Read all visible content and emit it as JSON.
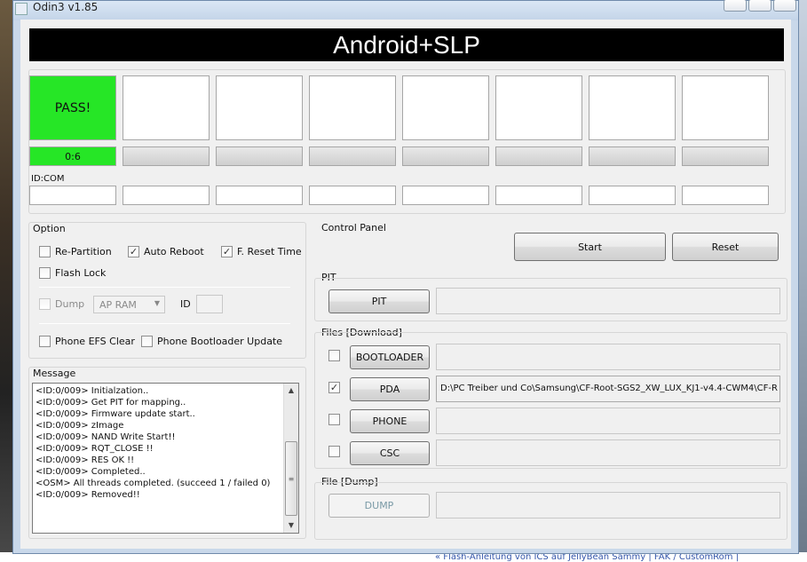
{
  "window": {
    "title": "Odin3 v1.85"
  },
  "banner": "Android+SLP",
  "slots": [
    {
      "status": "PASS!",
      "progress": "0:6",
      "pass": true
    },
    {
      "status": "",
      "progress": "",
      "pass": false
    },
    {
      "status": "",
      "progress": "",
      "pass": false
    },
    {
      "status": "",
      "progress": "",
      "pass": false
    },
    {
      "status": "",
      "progress": "",
      "pass": false
    },
    {
      "status": "",
      "progress": "",
      "pass": false
    },
    {
      "status": "",
      "progress": "",
      "pass": false
    },
    {
      "status": "",
      "progress": "",
      "pass": false
    }
  ],
  "idcom_label": "ID:COM",
  "option": {
    "title": "Option",
    "re_partition": {
      "label": "Re-Partition",
      "checked": false
    },
    "auto_reboot": {
      "label": "Auto Reboot",
      "checked": true
    },
    "f_reset_time": {
      "label": "F. Reset Time",
      "checked": true
    },
    "flash_lock": {
      "label": "Flash Lock",
      "checked": false
    },
    "dump": {
      "label": "Dump",
      "checked": false
    },
    "dump_select": "AP RAM",
    "id_label": "ID",
    "phone_efs_clear": {
      "label": "Phone EFS Clear",
      "checked": false
    },
    "phone_bootloader_update": {
      "label": "Phone Bootloader Update",
      "checked": false
    }
  },
  "message": {
    "title": "Message",
    "lines": [
      "<ID:0/009> Initialzation..",
      "<ID:0/009> Get PIT for mapping..",
      "<ID:0/009> Firmware update start..",
      "<ID:0/009> zImage",
      "<ID:0/009> NAND Write Start!!",
      "<ID:0/009> RQT_CLOSE !!",
      "<ID:0/009> RES OK !!",
      "<ID:0/009> Completed..",
      "<OSM> All threads completed. (succeed 1 / failed 0)",
      "<ID:0/009> Removed!!"
    ]
  },
  "control_panel": {
    "title": "Control Panel",
    "start": "Start",
    "reset": "Reset"
  },
  "pit": {
    "title": "PIT",
    "button": "PIT",
    "path": ""
  },
  "files": {
    "title": "Files [Download]",
    "rows": [
      {
        "label": "BOOTLOADER",
        "checked": false,
        "path": ""
      },
      {
        "label": "PDA",
        "checked": true,
        "path": "D:\\PC Treiber und Co\\Samsung\\CF-Root-SGS2_XW_LUX_KJ1-v4.4-CWM4\\CF-R"
      },
      {
        "label": "PHONE",
        "checked": false,
        "path": ""
      },
      {
        "label": "CSC",
        "checked": false,
        "path": ""
      }
    ]
  },
  "file_dump": {
    "title": "File [Dump]",
    "button": "DUMP",
    "path": ""
  },
  "background": {
    "top_text": "··· ····· ······ · ·········· ·· ··········",
    "bottom_text": "« Flash-Anleitung von ICS auf JellyBean Sammy | FAK / CustomRom |"
  }
}
